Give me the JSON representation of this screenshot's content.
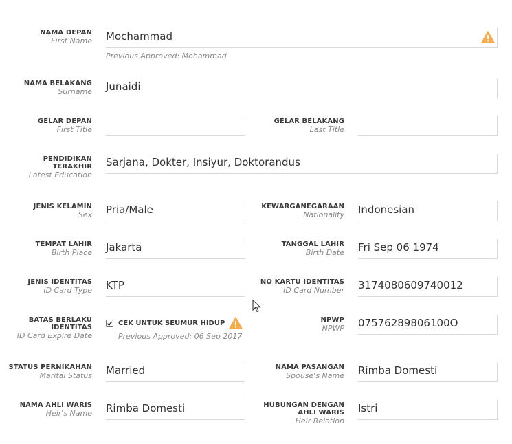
{
  "fields": {
    "first_name": {
      "label": "NAMA DEPAN",
      "sublabel": "First Name",
      "value": "Mochammad",
      "previous": "Previous Approved: Mohammad"
    },
    "surname": {
      "label": "NAMA BELAKANG",
      "sublabel": "Surname",
      "value": "Junaidi"
    },
    "first_title": {
      "label": "GELAR DEPAN",
      "sublabel": "First Title",
      "value": ""
    },
    "last_title": {
      "label": "GELAR BELAKANG",
      "sublabel": "Last Title",
      "value": ""
    },
    "latest_education": {
      "label_line1": "PENDIDIKAN",
      "label_line2": "TERAKHIR",
      "sublabel": "Latest Education",
      "value": "Sarjana, Dokter, Insiyur, Doktorandus"
    },
    "sex": {
      "label": "JENIS KELAMIN",
      "sublabel": "Sex",
      "value": "Pria/Male"
    },
    "nationality": {
      "label": "KEWARGANEGARAAN",
      "sublabel": "Nationality",
      "value": "Indonesian"
    },
    "birth_place": {
      "label": "TEMPAT LAHIR",
      "sublabel": "Birth Place",
      "value": "Jakarta"
    },
    "birth_date": {
      "label": "TANGGAL LAHIR",
      "sublabel": "Birth Date",
      "value": "Fri Sep 06 1974"
    },
    "id_card_type": {
      "label": "JENIS IDENTITAS",
      "sublabel": "ID Card Type",
      "value": "KTP"
    },
    "id_card_number": {
      "label": "NO KARTU IDENTITAS",
      "sublabel": "ID Card Number",
      "value": "3174080609740012"
    },
    "id_card_expire": {
      "label_line1": "BATAS BERLAKU",
      "label_line2": "IDENTITAS",
      "sublabel": "ID Card Expire Date",
      "checkbox_label": "CEK UNTUK SEUMUR HIDUP",
      "checked": true,
      "previous": "Previous Approved: 06 Sep 2017"
    },
    "npwp": {
      "label": "NPWP",
      "sublabel": "NPWP",
      "value": "07576289806100O"
    },
    "marital_status": {
      "label": "STATUS PERNIKAHAN",
      "sublabel": "Marital Status",
      "value": "Married"
    },
    "spouse_name": {
      "label": "NAMA PASANGAN",
      "sublabel": "Spouse's Name",
      "value": "Rimba Domesti"
    },
    "heir_name": {
      "label": "NAMA AHLI WARIS",
      "sublabel": "Heir's Name",
      "value": "Rimba Domesti"
    },
    "heir_relation": {
      "label_line1": "HUBUNGAN DENGAN",
      "label_line2": "AHLI WARIS",
      "sublabel": "Heir Relation",
      "value": "Istri"
    }
  },
  "colors": {
    "warning": "#f0ad4e",
    "label": "#3a3a3a",
    "sublabel": "#8a8a8a",
    "border": "#d9d9d9"
  },
  "icons": {
    "warning": "warning-triangle-icon",
    "cursor": "mouse-cursor-icon"
  }
}
